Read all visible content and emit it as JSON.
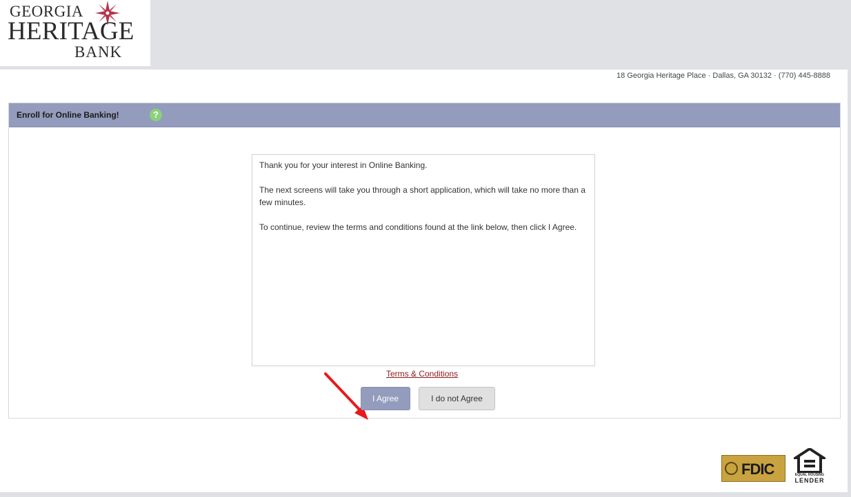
{
  "logo": {
    "line1": "GEORGIA",
    "line2": "HERITAGE",
    "line3": "BANK",
    "accent_color": "#b2344a"
  },
  "header": {
    "address": "18 Georgia Heritage Place · Dallas, GA 30132 · (770) 445-8888"
  },
  "panel": {
    "title": "Enroll for Online Banking!",
    "help_glyph": "?",
    "header_color": "#939cbd"
  },
  "message": {
    "p1": "Thank you for your interest in Online Banking.",
    "p2": "The next screens will take you through a short application, which will take no more than a few minutes.",
    "p3": "To continue, review the terms and conditions found at the link below, then click I Agree."
  },
  "links": {
    "terms": "Terms & Conditions"
  },
  "buttons": {
    "agree": "I Agree",
    "disagree": "I do not Agree"
  },
  "footer": {
    "fdic_label": "FDIC",
    "ehl_caption": "EQUAL HOUSING",
    "ehl_lender": "LENDER"
  },
  "icons": {
    "help": "help-icon",
    "compass": "compass-rose-icon",
    "arrow": "red-arrow-icon",
    "house": "equal-housing-house-icon"
  }
}
